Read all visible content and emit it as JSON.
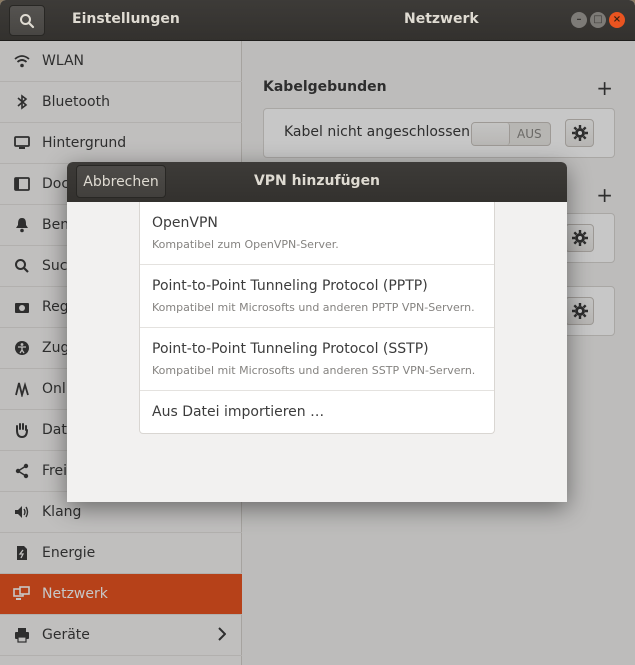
{
  "header": {
    "left_title": "Einstellungen",
    "right_title": "Netzwerk",
    "search_icon": "search-icon",
    "window_controls": {
      "minimize": "–",
      "maximize": "□",
      "close": "×"
    }
  },
  "sidebar": {
    "items": [
      {
        "label": "WLAN",
        "icon": "wifi-icon"
      },
      {
        "label": "Bluetooth",
        "icon": "bluetooth-icon"
      },
      {
        "label": "Hintergrund",
        "icon": "monitor-icon"
      },
      {
        "label": "Doc",
        "icon": "dock-icon"
      },
      {
        "label": "Ben",
        "icon": "bell-icon"
      },
      {
        "label": "Such",
        "icon": "search-icon"
      },
      {
        "label": "Reg",
        "icon": "camera-icon"
      },
      {
        "label": "Zug",
        "icon": "accessibility-icon"
      },
      {
        "label": "Onli",
        "icon": "share-icon"
      },
      {
        "label": "Dat",
        "icon": "hand-icon"
      },
      {
        "label": "Frei",
        "icon": "share-alt-icon"
      },
      {
        "label": "Klang",
        "icon": "speaker-icon"
      },
      {
        "label": "Energie",
        "icon": "power-icon"
      },
      {
        "label": "Netzwerk",
        "icon": "network-icon"
      },
      {
        "label": "Geräte",
        "icon": "printer-icon"
      }
    ],
    "active_index": 13
  },
  "main": {
    "wired_title": "Kabelgebunden",
    "cable_label": "Kabel nicht angeschlossen",
    "toggle_text": "AUS"
  },
  "dialog": {
    "cancel_label": "Abbrechen",
    "title": "VPN hinzufügen",
    "options": [
      {
        "title": "OpenVPN",
        "subtitle": "Kompatibel zum OpenVPN-Server."
      },
      {
        "title": "Point-to-Point Tunneling Protocol (PPTP)",
        "subtitle": "Kompatibel mit Microsofts und anderen PPTP VPN-Servern."
      },
      {
        "title": "Point-to-Point Tunneling Protocol (SSTP)",
        "subtitle": "Kompatibel mit Microsofts und anderen SSTP VPN-Servern."
      },
      {
        "title": "Aus Datei importieren …",
        "subtitle": ""
      }
    ]
  },
  "colors": {
    "accent": "#e95420",
    "headerbar": "#3a3835"
  }
}
